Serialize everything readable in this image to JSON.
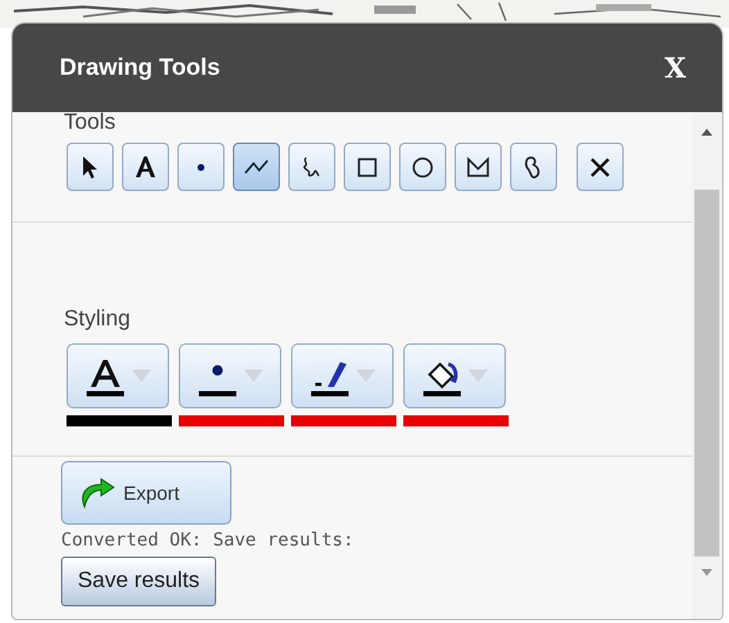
{
  "window": {
    "title": "Drawing Tools",
    "close": "X"
  },
  "tools_section": {
    "label": "Tools",
    "tools": [
      {
        "kind": "pointer",
        "selected": false
      },
      {
        "kind": "text",
        "selected": false
      },
      {
        "kind": "point",
        "selected": false
      },
      {
        "kind": "polyline",
        "selected": true
      },
      {
        "kind": "freehand",
        "selected": false
      },
      {
        "kind": "rectangle",
        "selected": false
      },
      {
        "kind": "circle",
        "selected": false
      },
      {
        "kind": "polygon",
        "selected": false
      },
      {
        "kind": "freeform",
        "selected": false
      },
      {
        "kind": "delete",
        "selected": false
      }
    ]
  },
  "styling_section": {
    "label": "Styling",
    "styles": [
      {
        "kind": "font",
        "color": "#000000"
      },
      {
        "kind": "marker",
        "color": "#e60000"
      },
      {
        "kind": "line",
        "color": "#e60000"
      },
      {
        "kind": "fill",
        "color": "#e60000"
      }
    ]
  },
  "export_button": "Export",
  "status": "Converted OK: Save results:",
  "save_button": "Save results"
}
